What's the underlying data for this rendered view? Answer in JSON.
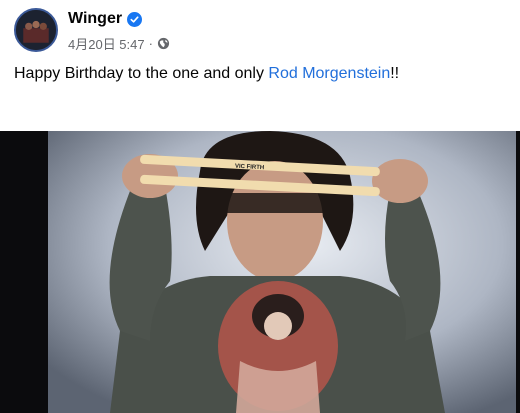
{
  "post": {
    "page_name": "Winger",
    "timestamp": "4月20日 5:47",
    "meta_separator": "·",
    "text_before": "Happy Birthday to the one and only ",
    "mention": "Rod Morgenstein",
    "text_after": "!!",
    "drumstick_text": "VIC FIRTH"
  },
  "icons": {
    "verified": "verified-badge-icon",
    "audience": "globe-icon"
  },
  "colors": {
    "link": "#216fdb",
    "verified": "#1877f2",
    "meta": "#65676b"
  }
}
